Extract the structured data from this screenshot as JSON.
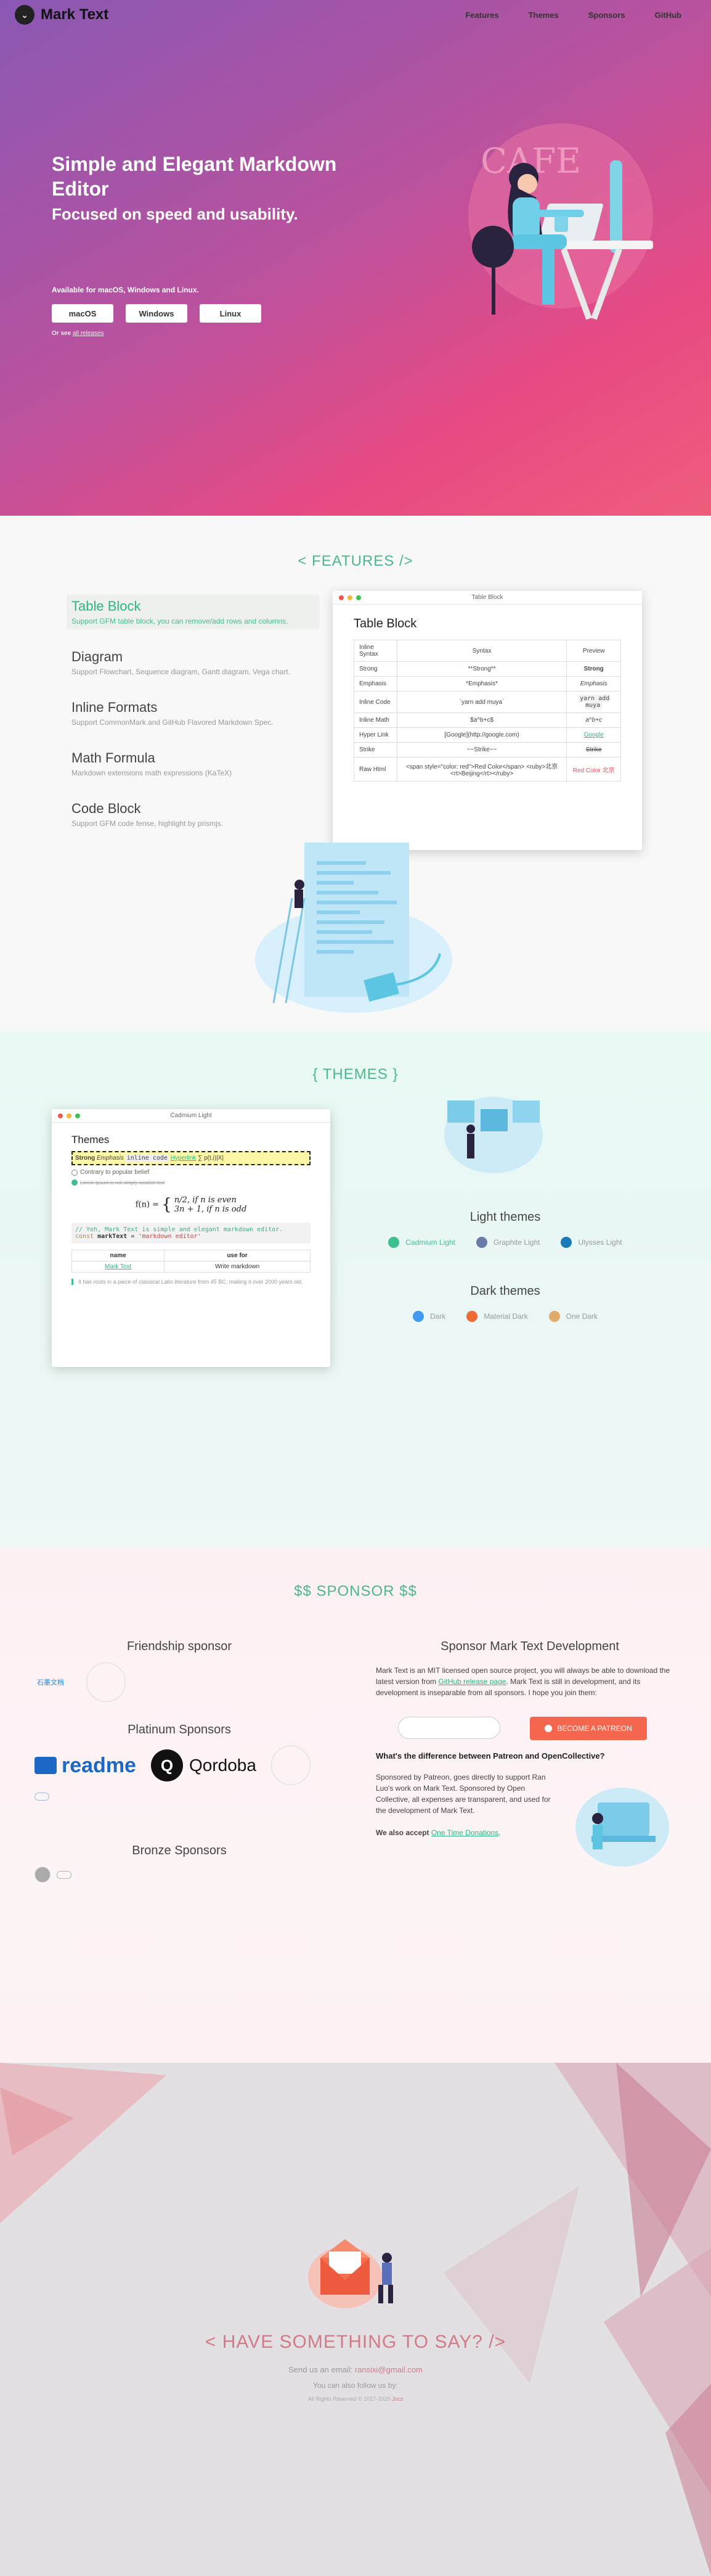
{
  "nav": {
    "brand": "Mark Text",
    "links": [
      "Features",
      "Themes",
      "Sponsors",
      "GitHub"
    ]
  },
  "hero": {
    "title": "Simple and Elegant Markdown Editor",
    "subtitle": "Focused on speed and usability.",
    "available": "Available for macOS, Windows and Linux.",
    "buttons": [
      "macOS",
      "Windows",
      "Linux"
    ],
    "release_prefix": "Or see",
    "release_link": "all releases"
  },
  "features": {
    "title": "< FEATURES />",
    "items": [
      {
        "name": "Table Block",
        "desc": "Support GFM table block, you can remove/add rows and columns."
      },
      {
        "name": "Diagram",
        "desc": "Support Flowchart, Sequence diagram, Gantt diagram, Vega chart."
      },
      {
        "name": "Inline Formats",
        "desc": "Support CommonMark and GitHub Flavored Markdown Spec."
      },
      {
        "name": "Math Formula",
        "desc": "Markdown extensions math expressions (KaTeX)"
      },
      {
        "name": "Code Block",
        "desc": "Support GFM code fense, highlight by prismjs."
      }
    ],
    "window": {
      "title": "Table Block",
      "heading": "Table Block",
      "headers": [
        "Inline Syntax",
        "Syntax",
        "Preview"
      ],
      "rows": [
        [
          "Strong",
          "**Strong**",
          "Strong"
        ],
        [
          "Emphasis",
          "*Emphasis*",
          "Emphasis"
        ],
        [
          "Inline Code",
          "`yarn add muya`",
          "yarn add muya"
        ],
        [
          "Inline Math",
          "$a^b+c$",
          "a^b+c"
        ],
        [
          "Hyper Link",
          "[Google](http://google.com)",
          "Google"
        ],
        [
          "Strike",
          "~~Strike~~",
          "Strike"
        ],
        [
          "Raw Html",
          "<span style=\"color: red\">Red Color</span> <ruby>北京<rt>Beijing</rt></ruby>",
          "Red Color 北京"
        ]
      ]
    }
  },
  "themes": {
    "title": "{ THEMES }",
    "window": {
      "title": "Cadmium Light",
      "heading": "Themes",
      "line": {
        "strong": "Strong",
        "emph": "Emphasis",
        "code": "inline code",
        "link": "Hyperlink",
        "math": "∑ p(t,i)|X|"
      },
      "task1": "Contrary to popular belief",
      "task2": "Lorem Ipsum is not simply random text",
      "math_lines": [
        "n/2,   if n is even",
        "3n + 1,   if n is odd"
      ],
      "math_fn": "f(n) =",
      "code_comment": "// Yeh, Mark Text is simple and elegant markdown editor.",
      "code_kw": "const",
      "code_var": "markText",
      "code_str": "'markdown editor'",
      "table_headers": [
        "name",
        "use for"
      ],
      "table_row": [
        "Mark Text",
        "Write markdown"
      ],
      "quote": "It has roots in a piece of classical Latin literature from 45 BC, making it over 2000 years old."
    },
    "light": {
      "title": "Light themes",
      "options": [
        {
          "name": "Cadmium Light",
          "color": "#3fbf8f"
        },
        {
          "name": "Graphite Light",
          "color": "#6c7aa6"
        },
        {
          "name": "Ulysses Light",
          "color": "#1b7ab8"
        }
      ]
    },
    "dark": {
      "title": "Dark themes",
      "options": [
        {
          "name": "Dark",
          "color": "#3e9bf0"
        },
        {
          "name": "Material Dark",
          "color": "#f06a34"
        },
        {
          "name": "One Dark",
          "color": "#e0ab6a"
        }
      ]
    }
  },
  "sponsor": {
    "title": "$$ SPONSOR $$",
    "friendship": "Friendship sponsor",
    "friendship_alt": "石墨文档",
    "platinum": "Platinum Sponsors",
    "readme": "readme",
    "qordoba": "Qordoba",
    "bronze": "Bronze Sponsors",
    "right_title": "Sponsor Mark Text Development",
    "p1_a": "Mark Text is an MIT licensed open source project, you will always be able to download the latest version from ",
    "p1_link": "GitHub release page",
    "p1_b": ". Mark Text is still in development, and its development is inseparable from all sponsors. I hope you join them:",
    "patreon": "BECOME A PATREON",
    "question": "What's the difference between Patreon and OpenCollective?",
    "p2": "Sponsored by Patreon, goes directly to support Ran Luo's work on Mark Text. Sponsored by Open Collective, all expenses are transparent, and used for the development of Mark Text.",
    "p3_a": "We also accept ",
    "p3_link": "One Time Donations",
    "p3_b": "."
  },
  "footer": {
    "title": "< HAVE SOMETHING TO SAY? />",
    "email_prefix": "Send us an email:",
    "email": "ransixi@gmail.com",
    "follow": "You can also follow us by:",
    "copy": "All Rights Reserved © 2017-2020",
    "author": "Jocs"
  }
}
